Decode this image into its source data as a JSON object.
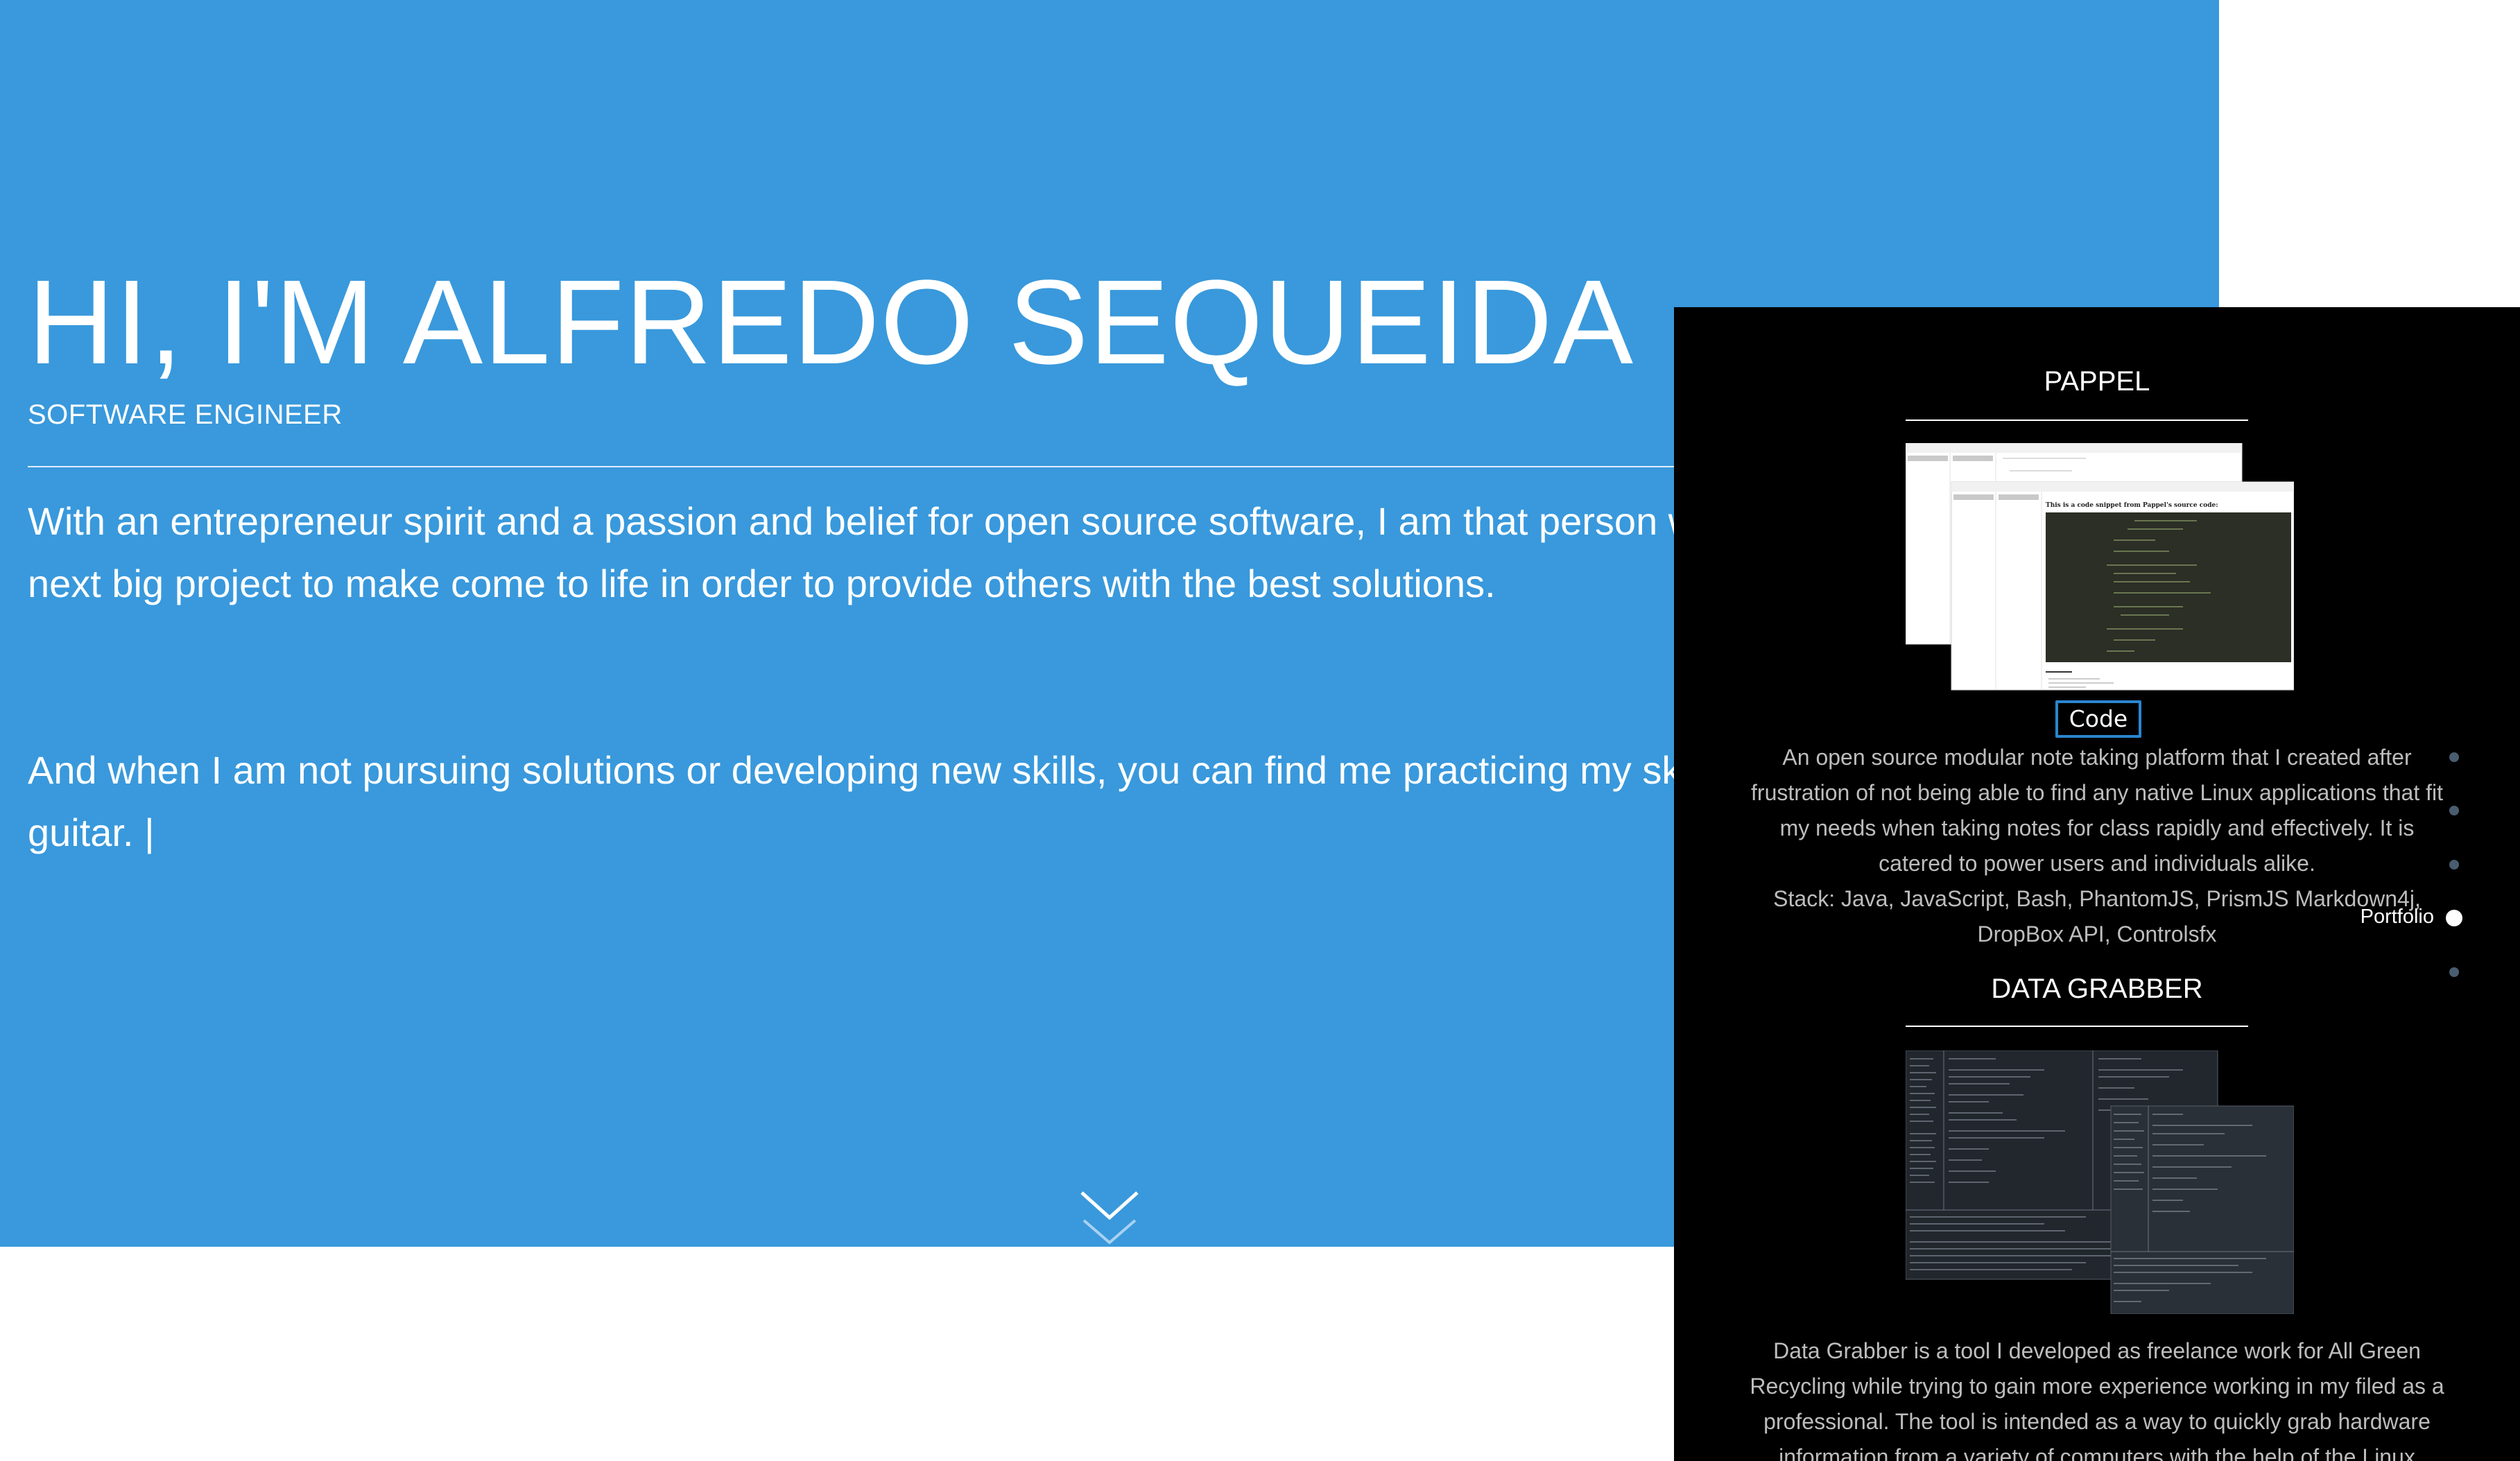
{
  "hero": {
    "title": "HI, I'M ALFREDO SEQUEIDA",
    "subtitle": "SOFTWARE ENGINEER",
    "bio": [
      "With an entrepreneur spirit and a passion and belief for open source software, I am that person who is always looking for the next big project to make come to life in order to provide others with the best solutions.",
      "And when I am not pursuing solutions or developing new skills, you can find me practicing my skateboarding or playing my guitar. |"
    ],
    "scroll_icon": "double-chevron-down-icon"
  },
  "portfolio": {
    "projects": [
      {
        "title": "PAPPEL",
        "screenshot_caption": "This is a code snippet from Pappel's source code:",
        "button": "Code",
        "description": "An open source modular note taking platform that I created after frustration of not being able to find any native Linux applications that fit my needs when taking notes for class rapidly and effectively. It is catered to power users and individuals alike.",
        "stack": "Stack: Java, JavaScript, Bash, PhantomJS, PrismJS Markdown4j, DropBox API, Controlsfx"
      },
      {
        "title": "DATA GRABBER",
        "description": "Data Grabber is a tool I developed as freelance work for All Green Recycling while trying to gain more experience working in my filed as a professional. The tool is intended as a way to quickly grab hardware information from a variety of computers with the help of the Linux"
      }
    ]
  },
  "section_nav": {
    "active_label": "Portfolio",
    "active_index": 3,
    "dot_count": 5
  },
  "colors": {
    "hero_bg": "#3999dc",
    "portfolio_bg": "#000000",
    "accent": "#2a86cf"
  }
}
